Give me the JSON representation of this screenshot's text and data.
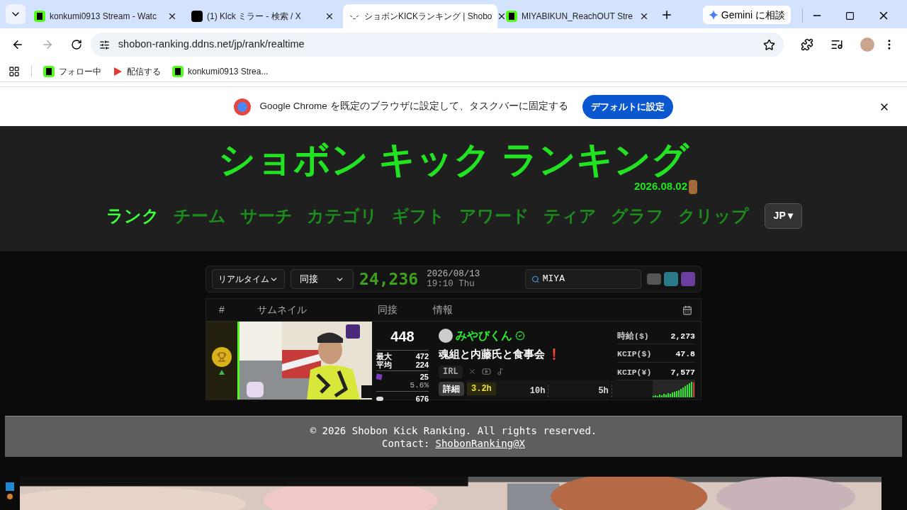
{
  "browser": {
    "tabs": [
      {
        "title": "konkumi0913 Stream - Watc",
        "selected": false
      },
      {
        "title": "(1) Klck ミラー - 検索 / X",
        "selected": false
      },
      {
        "title": "ショボンKICKランキング | Shobo",
        "selected": true
      },
      {
        "title": "MIYABIKUN_ReachOUT Stre",
        "selected": false
      }
    ],
    "gemini": "Gemini に相談",
    "address": "shobon-ranking.ddns.net/jp/rank/realtime",
    "bookmarks": [
      {
        "label": "フォロー中"
      },
      {
        "label": "配信する"
      },
      {
        "label": "konkumi0913 Strea..."
      }
    ]
  },
  "infobar": {
    "message": "Google Chrome を既定のブラウザに設定して、タスクバーに固定する",
    "button": "デフォルトに設定"
  },
  "site": {
    "logo": "ショボン キック ランキング",
    "date": "2026.08.02",
    "nav": [
      {
        "label": "ランク",
        "selected": true
      },
      {
        "label": "チーム",
        "selected": false
      },
      {
        "label": "サーチ",
        "selected": false
      },
      {
        "label": "カテゴリ",
        "selected": false
      },
      {
        "label": "ギフト",
        "selected": false
      },
      {
        "label": "アワード",
        "selected": false
      },
      {
        "label": "ティア",
        "selected": false
      },
      {
        "label": "グラフ",
        "selected": false
      },
      {
        "label": "クリップ",
        "selected": false
      }
    ],
    "language": "JP ▾"
  },
  "controls": {
    "period": "リアルタイム",
    "metric": "同接",
    "total": "24,236",
    "date": "2026/08/13",
    "time": "19:10 Thu",
    "search": "MIYA"
  },
  "table": {
    "columns": [
      "#",
      "サムネイル",
      "同接",
      "情報"
    ],
    "rows": [
      {
        "viewers": "448",
        "max_label": "最大",
        "max": "472",
        "avg_label": "平均",
        "avg": "224",
        "subs": "25",
        "sub_rate": "5.6%",
        "chats": "676",
        "name": "みやびくん",
        "verified": true,
        "title": "魂組と内藤氏と食事会",
        "alert": "❗",
        "category": "IRL",
        "detail": "詳細",
        "hours": "3.2h",
        "ticks": [
          "10h",
          "5h"
        ],
        "stats": [
          {
            "label": "時給($)",
            "value": "2,273"
          },
          {
            "label": "KCIP($)",
            "value": "47.8"
          },
          {
            "label": "KCIP(¥)",
            "value": "7,577"
          }
        ]
      }
    ]
  },
  "footer": {
    "copyright": "© 2026 Shobon Kick Ranking. All rights reserved.",
    "contact_label": "Contact:",
    "contact_link": "ShobonRanking@X"
  }
}
